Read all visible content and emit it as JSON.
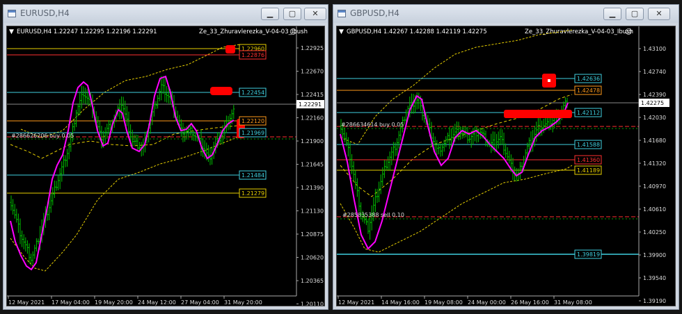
{
  "windows": {
    "left": {
      "title": "EURUSD,H4",
      "symbol_line": "EURUSD,H4  1.22247 1.22295 1.22196 1.22291",
      "indicator": "Ze_33_Zhuravlerezka_V-04-03_Ibush",
      "order_label": "#286626206 buy 0.05",
      "level_boxes": [
        {
          "value": "1.22960",
          "color": "#e8d000"
        },
        {
          "value": "1.22876",
          "color": "#ff3030"
        },
        {
          "value": "1.22454",
          "color": "#3fd0e0"
        },
        {
          "value": "1.22120",
          "color": "#ff9a1a"
        },
        {
          "value": "1.21969",
          "color": "#3fd0e0"
        },
        {
          "value": "1.21484",
          "color": "#3fd0e0"
        },
        {
          "value": "1.21279",
          "color": "#e8d000"
        }
      ],
      "current_price": "1.22291",
      "axis_labels": [
        "1.22925",
        "1.22670",
        "1.22415",
        "1.22160",
        "1.21900",
        "1.21645",
        "1.21390",
        "1.21130",
        "1.20875",
        "1.20620",
        "1.20365",
        "1.20110"
      ],
      "time_labels": [
        "12 May 2021",
        "17 May 04:00",
        "19 May 20:00",
        "24 May 12:00",
        "27 May 04:00",
        "31 May 20:00"
      ]
    },
    "right": {
      "title": "GBPUSD,H4",
      "symbol_line": "GBPUSD,H4  1.42267 1.42288 1.42119 1.42275",
      "indicator": "Ze_33_Zhuravlerezka_V-04-03_Ibush",
      "order_label_1": "#286634614 buy 0.05",
      "order_label_2": "#285835388 sell 0.10",
      "level_boxes": [
        {
          "value": "1.42636",
          "color": "#3fd0e0"
        },
        {
          "value": "1.42478",
          "color": "#ff9a1a"
        },
        {
          "value": "1.42112",
          "color": "#3fd0e0"
        },
        {
          "value": "1.41588",
          "color": "#3fd0e0"
        },
        {
          "value": "1.41360",
          "color": "#ff3030"
        },
        {
          "value": "1.41189",
          "color": "#e8d000"
        },
        {
          "value": "1.39819",
          "color": "#3fd0e0"
        }
      ],
      "current_price": "1.42275",
      "axis_labels": [
        "1.43100",
        "1.42740",
        "1.42390",
        "1.42030",
        "1.41680",
        "1.41320",
        "1.40970",
        "1.40610",
        "1.40250",
        "1.39900",
        "1.39540",
        "1.39190"
      ],
      "time_labels": [
        "12 May 2021",
        "14 May 16:00",
        "19 May 08:00",
        "24 May 00:00",
        "26 May 16:00",
        "31 May 08:00"
      ]
    }
  },
  "buttons": {
    "minimize": "▁",
    "maximize": "▢",
    "close": "✕"
  },
  "colors": {
    "bull": "#00c000",
    "magenta": "#ff00ff",
    "envelope": "#e8d000",
    "red": "#ff3030",
    "cyan": "#3fd0e0",
    "orange": "#ff9a1a",
    "mark": "#ff0000"
  }
}
